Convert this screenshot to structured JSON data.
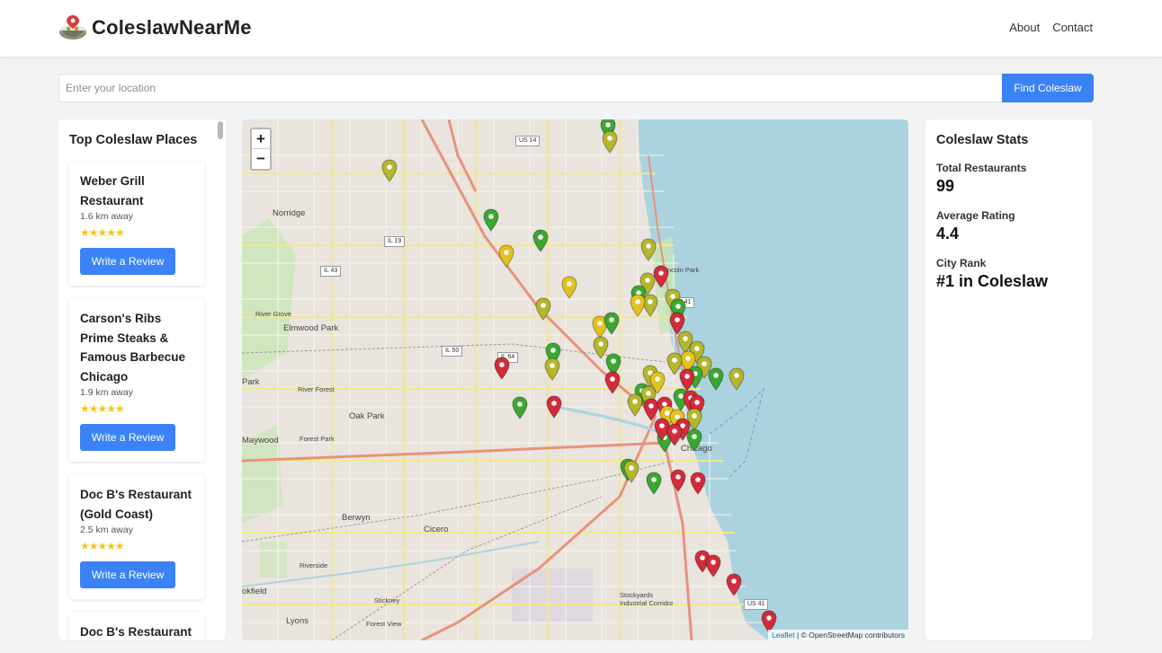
{
  "app": {
    "name": "ColeslawNearMe",
    "nav": [
      {
        "label": "About"
      },
      {
        "label": "Contact"
      }
    ]
  },
  "search": {
    "placeholder": "Enter your location",
    "value": "",
    "button_label": "Find Coleslaw"
  },
  "sidebar": {
    "title": "Top Coleslaw Places",
    "places": [
      {
        "name": "Weber Grill Restaurant",
        "distance": "1.6 km away",
        "stars": "★★★★★",
        "button": "Write a Review"
      },
      {
        "name": "Carson's Ribs Prime Steaks & Famous Barbecue Chicago",
        "distance": "1.9 km away",
        "stars": "★★★★★",
        "button": "Write a Review"
      },
      {
        "name": "Doc B's Restaurant (Gold Coast)",
        "distance": "2.5 km away",
        "stars": "★★★★★",
        "button": "Write a Review"
      },
      {
        "name": "Doc B's Restaurant",
        "distance": "",
        "stars": "",
        "button": ""
      }
    ]
  },
  "map": {
    "zoom_in": "+",
    "zoom_out": "−",
    "attribution_link": "Leaflet",
    "attribution_text": " | © OpenStreetMap contributors",
    "labels": [
      "Norridge",
      "Elmwood Park",
      "River Grove",
      "River Forest",
      "Oak Park",
      "Forest Park",
      "Maywood",
      "Berwyn",
      "Cicero",
      "Riverside",
      "Lyons",
      "Stickney",
      "Forest View",
      "Lincoln Park",
      "Chicago",
      "Stockyards Industrial Corridor",
      "Park",
      "okfield"
    ],
    "routes": [
      "US 14",
      "IL 19",
      "IL 43",
      "IL 50",
      "IL 64",
      "US 41",
      "US 41"
    ],
    "marker_colors": {
      "green": "#3aa830",
      "yellow": "#e3c21f",
      "olive": "#b5b52e",
      "red": "#d42b3a"
    }
  },
  "stats": {
    "title": "Coleslaw Stats",
    "total_label": "Total Restaurants",
    "total_value": "99",
    "rating_label": "Average Rating",
    "rating_value": "4.4",
    "rank_label": "City Rank",
    "rank_value": "#1 in Coleslaw"
  }
}
